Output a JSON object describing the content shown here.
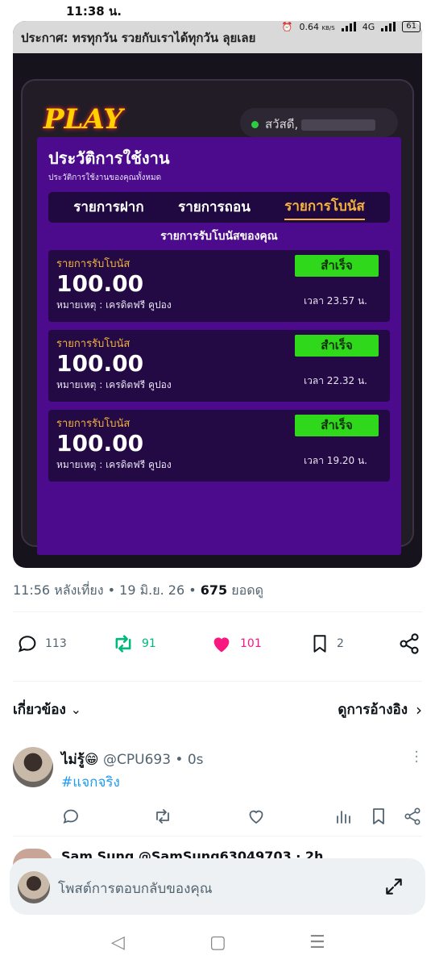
{
  "status_bar": {
    "time": "11:38 น.",
    "speed": "0.64",
    "speed_unit": "KB/S",
    "network": "4G",
    "battery": "61"
  },
  "embedded_screenshot": {
    "marquee": "ประกาศ: ทรทุกวัน รวยกับเราได้ทุกวัน ลุยเลย",
    "logo": "PLAY",
    "greeting": "สวัสดี,",
    "modal": {
      "title": "ประวัติการใช้งาน",
      "subtitle": "ประวัติการใช้งานของคุณทั้งหมด",
      "tabs": [
        "รายการฝาก",
        "รายการถอน",
        "รายการโบนัส"
      ],
      "active_tab": 2,
      "list_heading": "รายการรับโบนัสของคุณ",
      "items": [
        {
          "label": "รายการรับโบนัส",
          "amount": "100.00",
          "note": "หมายเหตุ : เครดิตฟรี คูปอง",
          "status": "สำเร็จ",
          "time": "เวลา 23.57 น."
        },
        {
          "label": "รายการรับโบนัส",
          "amount": "100.00",
          "note": "หมายเหตุ : เครดิตฟรี คูปอง",
          "status": "สำเร็จ",
          "time": "เวลา 22.32 น."
        },
        {
          "label": "รายการรับโบนัส",
          "amount": "100.00",
          "note": "หมายเหตุ : เครดิตฟรี คูปอง",
          "status": "สำเร็จ",
          "time": "เวลา 19.20 น."
        }
      ]
    }
  },
  "tweet_meta": {
    "datetime": "11:56 หลังเที่ยง • 19 มิ.ย. 26 • ",
    "views_count": "675",
    "views_label": " ยอดดู"
  },
  "actions": {
    "replies": "113",
    "reposts": "91",
    "likes": "101",
    "bookmarks": "2"
  },
  "related": {
    "label": "เกี่ยวข้อง",
    "quotes_link": "ดูการอ้างอิง"
  },
  "reply": {
    "name": "ไม่รู้😁",
    "handle": " @CPU693 • 0s",
    "text": "#แจกจริง"
  },
  "peek_reply": {
    "text": "Sam Sung @SamSung63049703 · 2h"
  },
  "composer": {
    "placeholder": "โพสต์การตอบกลับของคุณ"
  },
  "colors": {
    "modal_purple": "#4c0a8c",
    "accent_orange": "#f6b23c",
    "success_green": "#2fd81b",
    "repost_green": "#00ba7c",
    "like_pink": "#f91880",
    "link_blue": "#1d9bf0"
  }
}
